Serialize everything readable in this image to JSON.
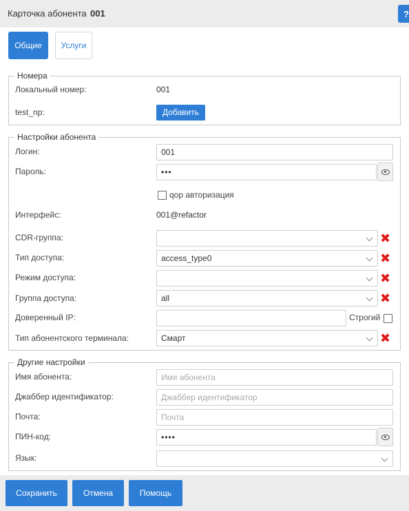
{
  "header": {
    "title": "Карточка абонента",
    "number": "001",
    "help_label": "?"
  },
  "tabs": [
    {
      "label": "Общие",
      "active": true
    },
    {
      "label": "Услуги",
      "active": false
    }
  ],
  "numbers_section": {
    "legend": "Номера",
    "local_number_label": "Локальный номер:",
    "local_number_value": "001",
    "test_np_label": "test_np:",
    "add_button": "Добавить"
  },
  "subscriber_settings": {
    "legend": "Настройки абонента",
    "login_label": "Логин:",
    "login_value": "001",
    "password_label": "Пароль:",
    "password_value": "•••",
    "qop_auth_label": "qop авторизация",
    "qop_auth_checked": false,
    "interface_label": "Интерфейс:",
    "interface_value": "001@refactor",
    "cdr_group_label": "CDR-группа:",
    "cdr_group_value": "",
    "access_type_label": "Тип доступа:",
    "access_type_value": "access_type0",
    "access_mode_label": "Режим доступа:",
    "access_mode_value": "",
    "access_group_label": "Группа доступа:",
    "access_group_value": "all",
    "trusted_ip_label": "Доверенный IP:",
    "trusted_ip_value": "",
    "strict_label": "Строгий",
    "strict_checked": false,
    "terminal_type_label": "Тип абонентского терминала:",
    "terminal_type_value": "Смарт"
  },
  "other_settings": {
    "legend": "Другие настройки",
    "name_label": "Имя абонента:",
    "name_placeholder": "Имя абонента",
    "jabber_label": "Джаббер идентификатор:",
    "jabber_placeholder": "Джаббер идентификатор",
    "email_label": "Почта:",
    "email_placeholder": "Почта",
    "pin_label": "ПИН-код:",
    "pin_value": "••••",
    "language_label": "Язык:",
    "language_value": ""
  },
  "footer": {
    "save": "Сохранить",
    "cancel": "Отмена",
    "help": "Помощь"
  },
  "icons": {
    "delete": "delete-x-icon",
    "eye": "eye-icon",
    "chevron": "chevron-down-icon",
    "help": "help-icon"
  },
  "colors": {
    "primary": "#2e7ed6",
    "delete": "#e01b1b",
    "header_bg": "#ececec"
  }
}
